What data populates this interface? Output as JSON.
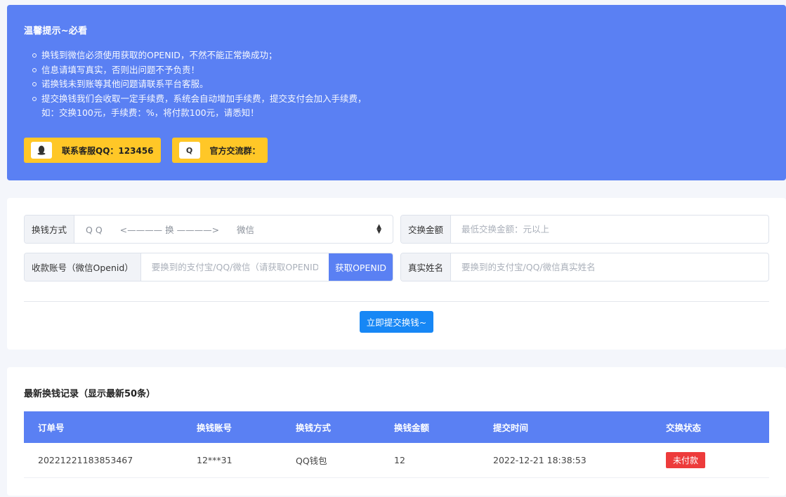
{
  "notice": {
    "title": "温馨提示~必看",
    "items": [
      "换钱到微信必须使用获取的OPENID，不然不能正常换成功；",
      "信息请填写真实，否则出问题不予负责！",
      "诺换钱未到账等其他问题请联系平台客服。",
      "提交换钱我们会收取一定手续费，系统会自动增加手续费，提交支付会加入手续费，",
      "如：交换100元，手续费：%，将付款100元，请悉知！"
    ],
    "qq_button": "联系客服QQ：123456",
    "group_button": "官方交流群：",
    "group_icon_letter": "Q"
  },
  "form": {
    "method_label": "换钱方式",
    "method_value": "Q Q　　<———— 换 ————>　　微信",
    "amount_label": "交换金额",
    "amount_placeholder": "最低交换金额：元以上",
    "account_label": "收款账号（微信Openid）",
    "account_placeholder": "要换到的支付宝/QQ/微信（请获取OPENID）",
    "get_openid": "获取OPENID",
    "name_label": "真实姓名",
    "name_placeholder": "要换到的支付宝/QQ/微信真实姓名",
    "submit": "立即提交换钱~"
  },
  "records": {
    "title": "最新换钱记录（显示最新50条）",
    "columns": [
      "订单号",
      "换钱账号",
      "换钱方式",
      "换钱金额",
      "提交时间",
      "交换状态"
    ],
    "rows": [
      {
        "order": "20221221183853467",
        "account": "12***31",
        "method": "QQ钱包",
        "amount": "12",
        "time": "2022-12-21 18:38:53",
        "status": "未付款"
      }
    ]
  },
  "colors": {
    "primary": "#5a80f3",
    "accent_yellow": "#ffc727",
    "submit_blue": "#1787f5",
    "badge_red": "#ed3b3b"
  },
  "icons": {
    "qq": "penguin-icon",
    "group": "q-letter-icon",
    "select": "select-arrows-icon"
  }
}
